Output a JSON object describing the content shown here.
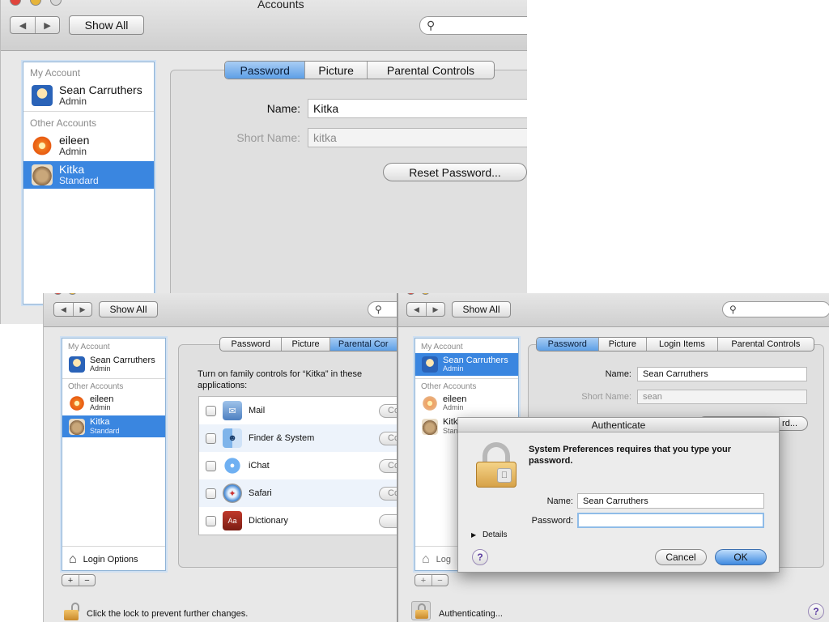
{
  "colors": {
    "selection": "#3a86e0",
    "accent": "#5d9fe6"
  },
  "window_main": {
    "title": "Accounts",
    "show_all": "Show All",
    "sidebar": {
      "my_account_header": "My Account",
      "my_account": {
        "name": "Sean Carruthers",
        "role": "Admin",
        "avatar": "astronaut-avatar"
      },
      "other_header": "Other Accounts",
      "others": [
        {
          "name": "eileen",
          "role": "Admin",
          "avatar": "flower-avatar"
        },
        {
          "name": "Kitka",
          "role": "Standard",
          "avatar": "cat-avatar"
        }
      ]
    },
    "tabs": [
      "Password",
      "Picture",
      "Parental Controls"
    ],
    "name_label": "Name:",
    "name_value": "Kitka",
    "short_name_label": "Short Name:",
    "short_name_value": "kitka",
    "reset_password": "Reset Password..."
  },
  "window_parental": {
    "show_all": "Show All",
    "sidebar": {
      "my_account_header": "My Account",
      "my_account": {
        "name": "Sean Carruthers",
        "role": "Admin"
      },
      "other_header": "Other Accounts",
      "others": [
        {
          "name": "eileen",
          "role": "Admin"
        },
        {
          "name": "Kitka",
          "role": "Standard"
        }
      ]
    },
    "login_options": "Login Options",
    "add": "+",
    "remove": "−",
    "tabs": [
      "Password",
      "Picture",
      "Parental Cor"
    ],
    "instruction": "Turn on family controls for “Kitka” in these applications:",
    "apps": [
      {
        "name": "Mail",
        "button": "Co"
      },
      {
        "name": "Finder & System",
        "button": "Co"
      },
      {
        "name": "iChat",
        "button": "Co"
      },
      {
        "name": "Safari",
        "button": "Co"
      },
      {
        "name": "Dictionary",
        "button": ""
      }
    ],
    "lock_text": "Click the lock to prevent further changes."
  },
  "window_auth": {
    "show_all": "Show All",
    "sidebar": {
      "my_account_header": "My Account",
      "my_account": {
        "name": "Sean Carruthers",
        "role": "Admin"
      },
      "other_header": "Other Accounts",
      "others": [
        {
          "name": "eileen",
          "role": "Admin"
        },
        {
          "name": "Kitk",
          "role": "Stan"
        }
      ]
    },
    "login_partial": "Log",
    "add": "+",
    "remove": "−",
    "tabs": [
      "Password",
      "Picture",
      "Login Items",
      "Parental Controls"
    ],
    "name_label": "Name:",
    "name_value": "Sean Carruthers",
    "short_name_label": "Short Name:",
    "short_name_value": "sean",
    "hidden_button_partial": "rd...",
    "status": "Authenticating...",
    "help": "?",
    "dialog": {
      "title": "Authenticate",
      "message": "System Preferences requires that you type your password.",
      "name_label": "Name:",
      "name_value": "Sean Carruthers",
      "password_label": "Password:",
      "password_value": "",
      "details": "Details",
      "help": "?",
      "cancel": "Cancel",
      "ok": "OK"
    }
  }
}
